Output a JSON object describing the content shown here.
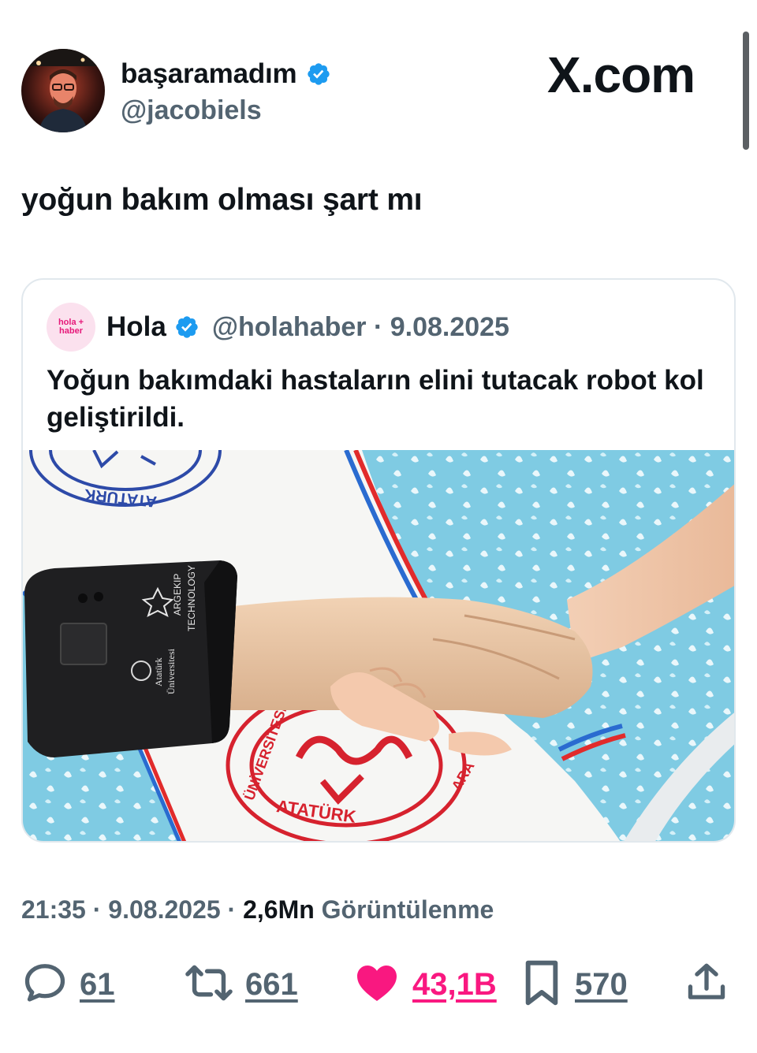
{
  "author": {
    "display_name": "başaramadım",
    "handle": "@jacobiels"
  },
  "brand": "X.com",
  "tweet": {
    "text": "yoğun bakım olması şart mı"
  },
  "quote": {
    "avatar_text_1": "hola +",
    "avatar_text_2": "haber",
    "name": "Hola",
    "handle_date": "@holahaber · 9.08.2025",
    "text": "Yoğun bakımdaki hastaların elini tutacak robot kol geliştirildi.",
    "image_text": {
      "device_brand_1": "ARGEKIP",
      "device_brand_2": "TECHNOLOGY",
      "device_univ_1": "Atatürk",
      "device_univ_2": "Üniversitesi",
      "seal_top": "ATATÜRK",
      "seal_bottom": "ATATÜRK",
      "seal_side": "ÜNİVERSİTESİ",
      "seal_side_2": "ARA"
    }
  },
  "meta": {
    "time": "21:35",
    "sep1": " · ",
    "date": "9.08.2025",
    "sep2": " · ",
    "views_count": "2,6Mn",
    "views_label": " Görüntülenme"
  },
  "actions": {
    "replies": "61",
    "reposts": "661",
    "likes": "43,1B",
    "bookmarks": "570"
  },
  "colors": {
    "verified": "#1d9bf0",
    "like": "#f91880",
    "muted": "#536471",
    "text": "#0f1419"
  },
  "icons": [
    "verified-badge-icon",
    "reply-icon",
    "repost-icon",
    "like-icon",
    "bookmark-icon",
    "share-icon"
  ]
}
